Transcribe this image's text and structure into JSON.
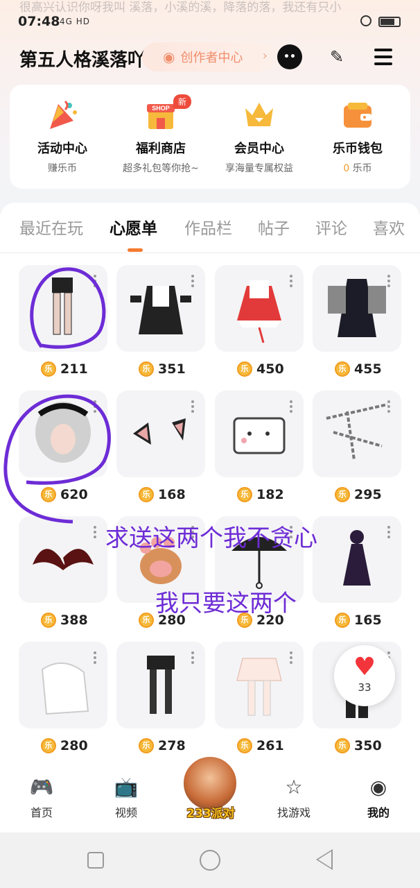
{
  "marquee": "很高兴认识你呀我叫 溪落，小溪的溪，降落的落，我还有只小",
  "status": {
    "time": "07:48",
    "icons": "4G HD"
  },
  "header": {
    "username": "第五人格溪落吖呀",
    "creator_label": "创作者中心",
    "chevron": "›"
  },
  "quick": [
    {
      "title": "活动中心",
      "sub": "赚乐币",
      "icon": "party-popper-icon"
    },
    {
      "title": "福利商店",
      "sub": "超多礼包等你抢~",
      "icon": "shop-icon",
      "badge": "新",
      "shop_text": "SHOP"
    },
    {
      "title": "会员中心",
      "sub": "享海量专属权益",
      "icon": "crown-icon"
    },
    {
      "title": "乐币钱包",
      "sub_value": "0",
      "sub_unit": " 乐币",
      "icon": "wallet-icon"
    }
  ],
  "tabs": [
    "最近在玩",
    "心愿单",
    "作品栏",
    "帖子",
    "评论",
    "喜欢"
  ],
  "active_tab": "心愿单",
  "items": [
    {
      "price": "211",
      "icon": "stockings-icon"
    },
    {
      "price": "351",
      "icon": "maid-dress-icon"
    },
    {
      "price": "450",
      "icon": "red-dress-icon"
    },
    {
      "price": "455",
      "icon": "gothic-outfit-icon"
    },
    {
      "price": "620",
      "icon": "silver-hair-icon"
    },
    {
      "price": "168",
      "icon": "cat-ears-icon"
    },
    {
      "price": "182",
      "icon": "pixel-cat-icon"
    },
    {
      "price": "295",
      "icon": "chains-icon"
    },
    {
      "price": "388",
      "icon": "bat-wings-icon"
    },
    {
      "price": "280",
      "icon": "paw-icon"
    },
    {
      "price": "220",
      "icon": "lace-umbrella-icon"
    },
    {
      "price": "165",
      "icon": "dark-doll-icon"
    },
    {
      "price": "280",
      "icon": "white-glove-icon"
    },
    {
      "price": "278",
      "icon": "garter-stockings-icon"
    },
    {
      "price": "261",
      "icon": "white-skirt-icon"
    },
    {
      "price": "350",
      "icon": "black-boots-icon"
    }
  ],
  "coin_glyph": "乐",
  "favorite": {
    "count": "33",
    "icon": "heart-icon"
  },
  "annotations": [
    "求送这两个我不贪心",
    "我只要这两个"
  ],
  "nav": [
    {
      "label": "首页",
      "icon": "gamepad-icon",
      "glyph": "🎮"
    },
    {
      "label": "视频",
      "icon": "tv-icon",
      "glyph": "📺"
    },
    {
      "label": "233派对",
      "icon": "party-avatar-icon"
    },
    {
      "label": "找游戏",
      "icon": "star-icon",
      "glyph": "☆"
    },
    {
      "label": "我的",
      "icon": "profile-icon",
      "glyph": "◉"
    }
  ],
  "colors": {
    "accent": "#f57a2e",
    "annotation": "#6d2cd6",
    "coin": "#f6b93b"
  }
}
